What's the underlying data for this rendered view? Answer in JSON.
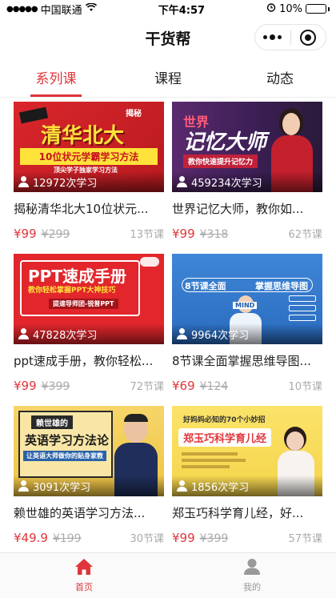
{
  "status_bar": {
    "carrier": "中国联通",
    "time": "下午4:57",
    "battery": "10%"
  },
  "nav": {
    "title": "干货帮"
  },
  "tabs": [
    {
      "label": "系列课",
      "active": true
    },
    {
      "label": "课程",
      "active": false
    },
    {
      "label": "动态",
      "active": false
    }
  ],
  "courses": [
    {
      "title": "揭秘清华北大10位状元...",
      "learners": "12972次学习",
      "price": "¥99",
      "old_price": "¥299",
      "lessons": "13节课",
      "art": {
        "l1": "揭秘",
        "l2": "清华北大",
        "l3": "10位状元学霸学习方法",
        "l4": "顶尖学子独家学习方法"
      }
    },
    {
      "title": "世界记忆大师，教你如...",
      "learners": "459234次学习",
      "price": "¥99",
      "old_price": "¥318",
      "lessons": "62节课",
      "art": {
        "l1": "世界",
        "l2": "记忆大师",
        "l3": "教你快速提升记忆力"
      }
    },
    {
      "title": "ppt速成手册，教你轻松...",
      "learners": "47828次学习",
      "price": "¥99",
      "old_price": "¥399",
      "lessons": "72节课",
      "art": {
        "l1": "PPT速成手册",
        "l2": "教你轻松掌握PPT大神技巧",
        "l3": "提速导师团-锐普PPT"
      }
    },
    {
      "title": "8节课全面掌握思维导图...",
      "learners": "9964次学习",
      "price": "¥69",
      "old_price": "¥124",
      "lessons": "10节课",
      "art": {
        "l1": "8节课全面",
        "l2": "掌握思维导图",
        "l3": "MIND"
      }
    },
    {
      "title": "赖世雄的英语学习方法...",
      "learners": "3091次学习",
      "price": "¥49.9",
      "old_price": "¥199",
      "lessons": "30节课",
      "art": {
        "l1": "赖世雄的",
        "l2": "英语学习方法论",
        "l3": "让英语大师做你的贴身家教"
      }
    },
    {
      "title": "郑玉巧科学育儿经，好...",
      "learners": "1856次学习",
      "price": "¥99",
      "old_price": "¥399",
      "lessons": "57节课",
      "art": {
        "l1": "好妈妈必知的70个小妙招",
        "l2": "郑玉巧科学育儿经"
      }
    }
  ],
  "bottom_nav": [
    {
      "label": "首页",
      "active": true,
      "icon": "home-icon"
    },
    {
      "label": "我的",
      "active": false,
      "icon": "profile-icon"
    }
  ],
  "colors": {
    "accent": "#e0353b"
  }
}
